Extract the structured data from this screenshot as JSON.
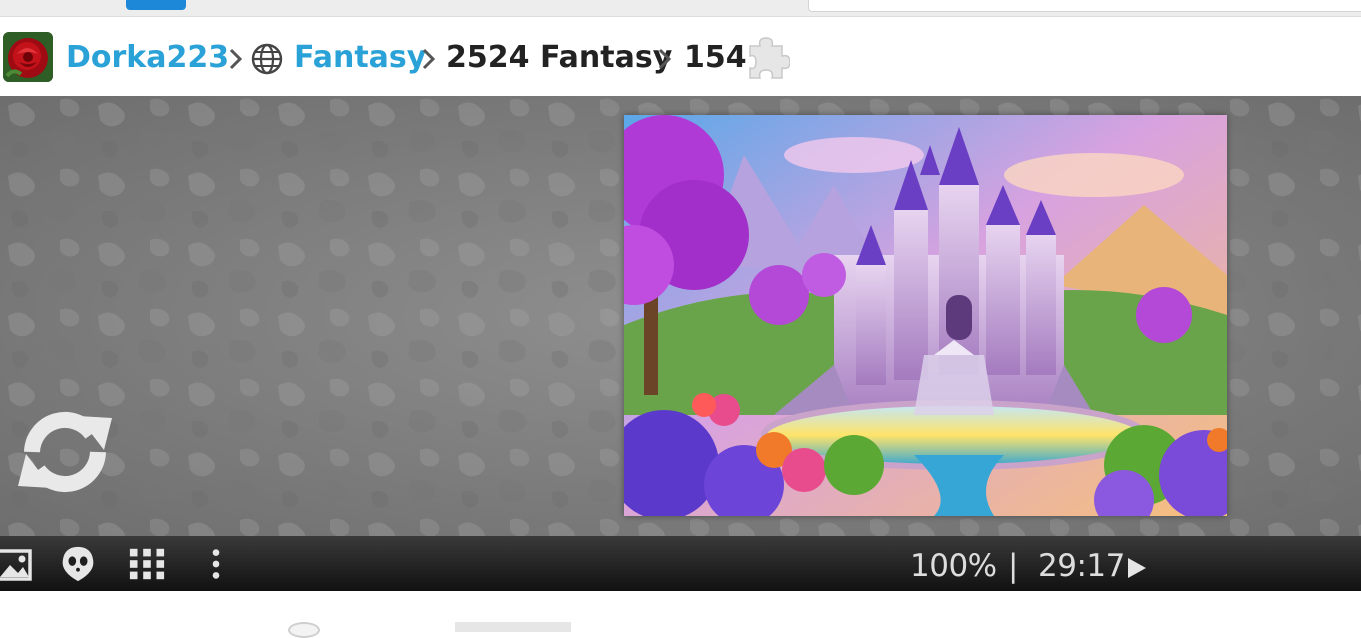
{
  "breadcrumb": {
    "user": "Dorka223",
    "category": "Fantasy",
    "puzzle_title": "2524 Fantasy",
    "piece_count": "154"
  },
  "icons": {
    "avatar": "rose-avatar-icon",
    "category": "globe-icon",
    "pieces": "puzzle-piece-icon",
    "refresh": "refresh-icon",
    "toolbar": [
      "image-icon",
      "ghost-icon",
      "grid-icon",
      "more-vertical-icon"
    ],
    "play": "play-icon"
  },
  "status": {
    "zoom": "100%",
    "separator": "|",
    "timer": "29:17"
  },
  "colors": {
    "link": "#2aa2d7",
    "title": "#222222",
    "toolbar_text": "#dddddd"
  }
}
